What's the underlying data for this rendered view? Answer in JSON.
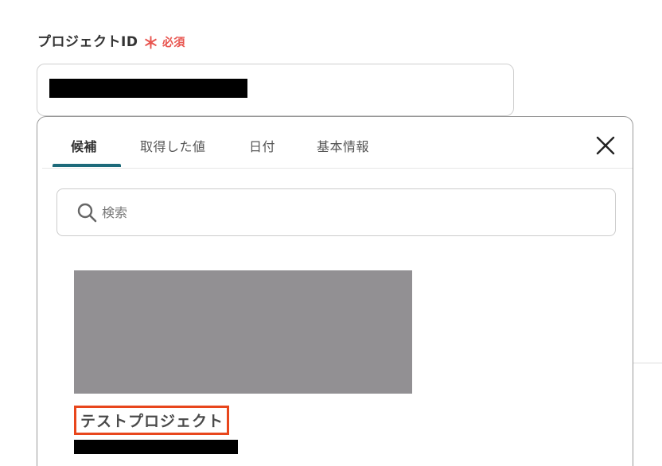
{
  "field": {
    "label": "プロジェクトID",
    "required_mark": "＊",
    "required_text": "必須"
  },
  "dropdown": {
    "tabs": [
      {
        "label": "候補",
        "active": true
      },
      {
        "label": "取得した値",
        "active": false
      },
      {
        "label": "日付",
        "active": false
      },
      {
        "label": "基本情報",
        "active": false
      }
    ],
    "close_icon": "close-icon",
    "search": {
      "placeholder": "検索",
      "value": "",
      "icon": "search-icon"
    },
    "candidates": [
      {
        "title": "テストプロジェクト",
        "highlighted": true
      }
    ]
  },
  "colors": {
    "required": "#e8544e",
    "tab_accent": "#1d6a7a",
    "highlight_border": "#e8461c",
    "image_placeholder": "#929093"
  }
}
